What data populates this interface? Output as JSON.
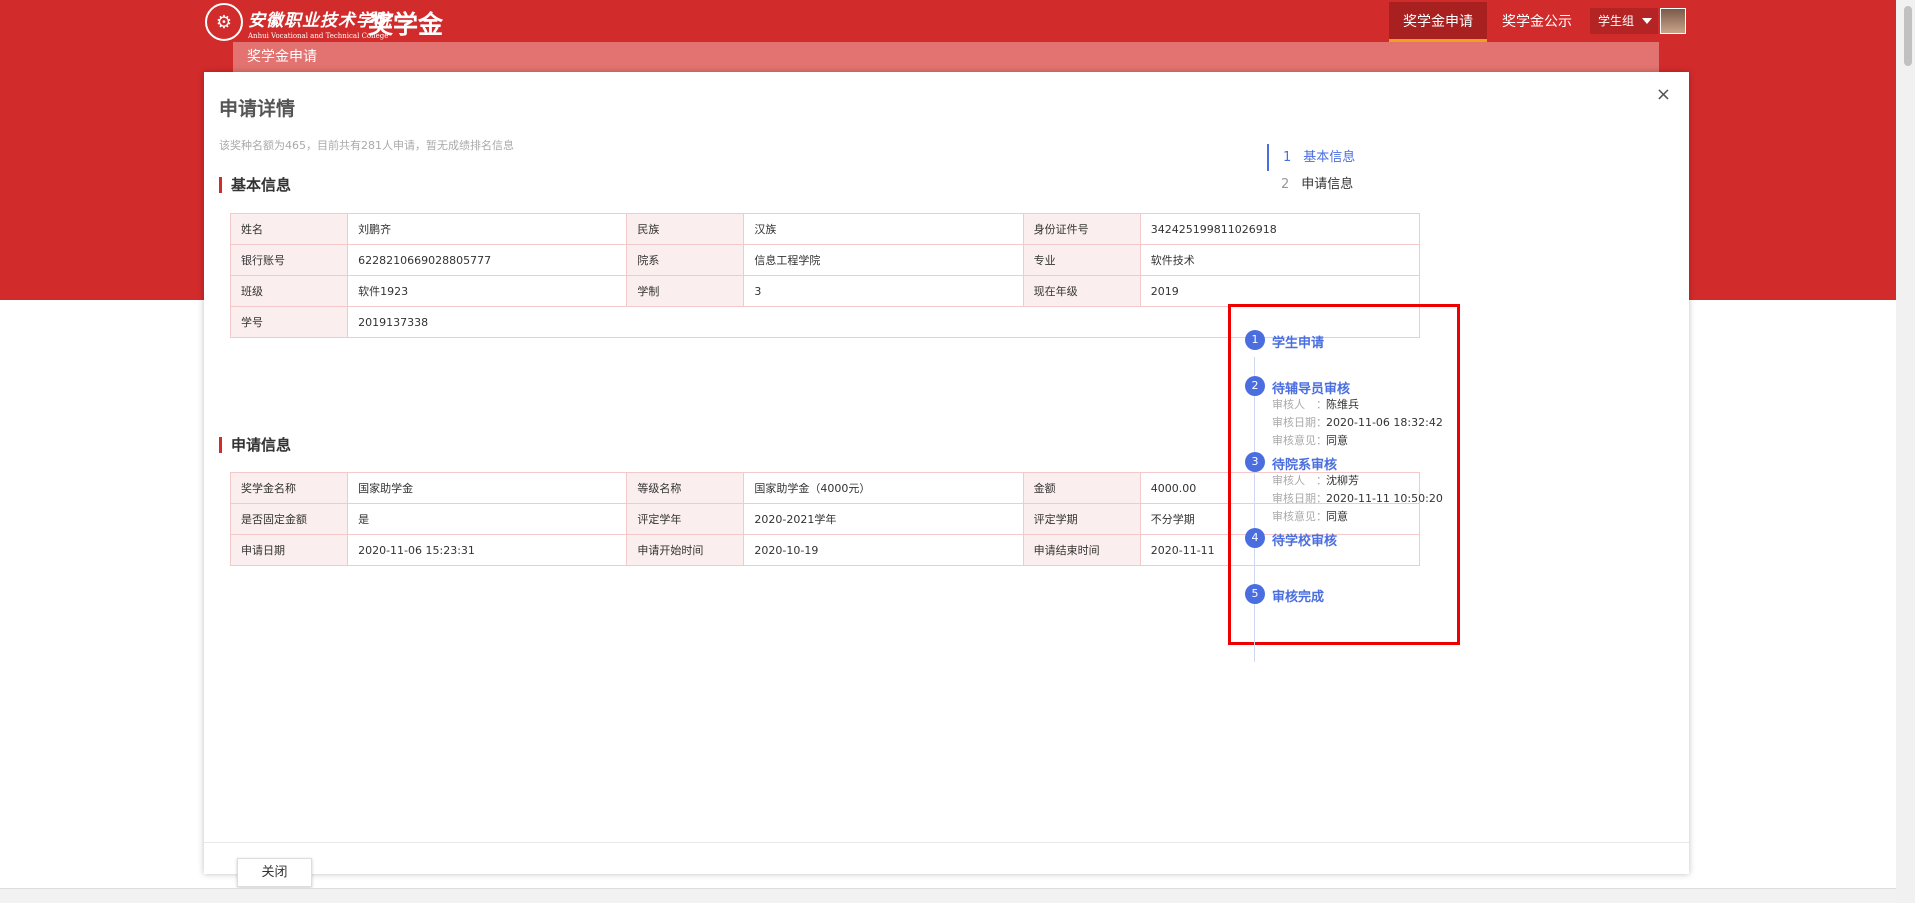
{
  "header": {
    "school_cn": "安徽职业技术学院",
    "school_en": "Anhui Vocational and Technical College",
    "app_title": "奖学金",
    "nav": [
      "奖学金申请",
      "奖学金公示"
    ],
    "user_role": "学生组"
  },
  "sub_band": "奖学金申请",
  "modal": {
    "title": "申请详情",
    "hint": "该奖种名额为465，目前共有281人申请，暂无成绩排名信息",
    "basic_title": "基本信息",
    "apply_title": "申请信息",
    "close_label": "关闭"
  },
  "basic_rows": [
    [
      [
        "姓名",
        "刘鹏齐"
      ],
      [
        "民族",
        "汉族"
      ],
      [
        "身份证件号",
        "342425199811026918"
      ]
    ],
    [
      [
        "银行账号",
        "6228210669028805777"
      ],
      [
        "院系",
        "信息工程学院"
      ],
      [
        "专业",
        "软件技术"
      ]
    ],
    [
      [
        "班级",
        "软件1923"
      ],
      [
        "学制",
        "3"
      ],
      [
        "现在年级",
        "2019"
      ]
    ],
    [
      [
        "学号",
        "2019137338"
      ]
    ]
  ],
  "apply_rows": [
    [
      [
        "奖学金名称",
        "国家助学金"
      ],
      [
        "等级名称",
        "国家助学金（4000元）"
      ],
      [
        "金额",
        "4000.00"
      ]
    ],
    [
      [
        "是否固定金额",
        "是"
      ],
      [
        "评定学年",
        "2020-2021学年"
      ],
      [
        "评定学期",
        "不分学期"
      ]
    ],
    [
      [
        "申请日期",
        "2020-11-06 15:23:31"
      ],
      [
        "申请开始时间",
        "2020-10-19"
      ],
      [
        "申请结束时间",
        "2020-11-11"
      ]
    ]
  ],
  "toc": [
    {
      "num": "1",
      "label": "基本信息"
    },
    {
      "num": "2",
      "label": "申请信息"
    }
  ],
  "steps": [
    {
      "num": "1",
      "label": "学生申请"
    },
    {
      "num": "2",
      "label": "待辅导员审核",
      "reviewer_key": "审核人　：",
      "reviewer": "陈维兵",
      "date_key": "审核日期：",
      "date": "2020-11-06 18:32:42",
      "opinion_key": "审核意见：",
      "opinion": "同意"
    },
    {
      "num": "3",
      "label": "待院系审核",
      "reviewer_key": "审核人　：",
      "reviewer": "沈柳芳",
      "date_key": "审核日期：",
      "date": "2020-11-11 10:50:20",
      "opinion_key": "审核意见：",
      "opinion": "同意"
    },
    {
      "num": "4",
      "label": "待学校审核"
    },
    {
      "num": "5",
      "label": "审核完成"
    }
  ]
}
